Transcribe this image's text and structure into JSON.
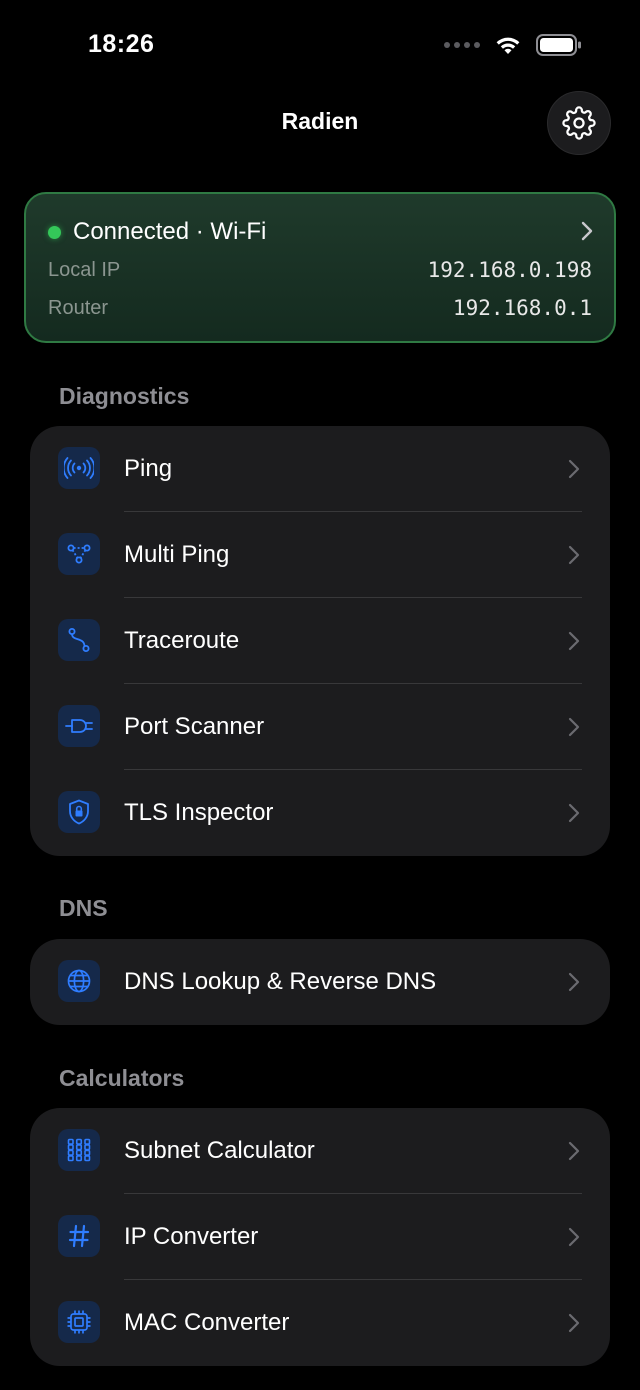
{
  "status_bar": {
    "time": "18:26"
  },
  "header": {
    "title": "Radien"
  },
  "connection": {
    "status": "Connected · Wi-Fi",
    "status_color": "#34c759",
    "rows": [
      {
        "label": "Local IP",
        "value": "192.168.0.198"
      },
      {
        "label": "Router",
        "value": "192.168.0.1"
      }
    ]
  },
  "sections": [
    {
      "title": "Diagnostics",
      "items": [
        {
          "label": "Ping",
          "icon": "antenna-icon"
        },
        {
          "label": "Multi Ping",
          "icon": "network-nodes-icon"
        },
        {
          "label": "Traceroute",
          "icon": "route-icon"
        },
        {
          "label": "Port Scanner",
          "icon": "plug-icon"
        },
        {
          "label": "TLS Inspector",
          "icon": "lock-shield-icon"
        }
      ]
    },
    {
      "title": "DNS",
      "items": [
        {
          "label": "DNS Lookup & Reverse DNS",
          "icon": "globe-icon"
        }
      ]
    },
    {
      "title": "Calculators",
      "items": [
        {
          "label": "Subnet Calculator",
          "icon": "grid-icon"
        },
        {
          "label": "IP Converter",
          "icon": "hash-icon"
        },
        {
          "label": "MAC Converter",
          "icon": "chip-icon"
        }
      ]
    }
  ],
  "colors": {
    "accent": "#2f7dff",
    "icon_bg": "#15294a",
    "card_bg": "#1c1c1e"
  }
}
